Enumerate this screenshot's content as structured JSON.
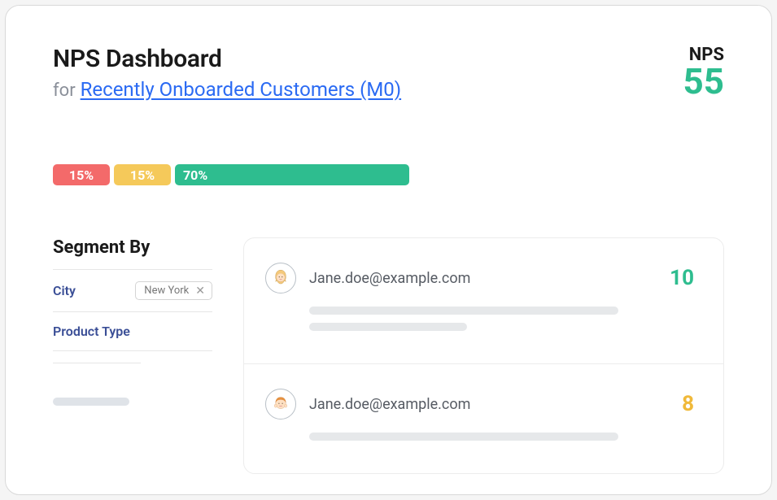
{
  "header": {
    "title": "NPS Dashboard",
    "for_prefix": "for",
    "segment_link": "Recently Onboarded Customers (M0)",
    "nps_label": "NPS",
    "nps_value": "55"
  },
  "distribution": {
    "detractor_pct": "15%",
    "passive_pct": "15%",
    "promoter_pct": "70%"
  },
  "segment_by": {
    "title": "Segment By",
    "rows": [
      {
        "label": "City",
        "chip": "New York"
      },
      {
        "label": "Product Type"
      }
    ]
  },
  "responses": [
    {
      "email": "Jane.doe@example.com",
      "score": "10",
      "score_class": "green",
      "avatar": "female"
    },
    {
      "email": "Jane.doe@example.com",
      "score": "8",
      "score_class": "yellow",
      "avatar": "male"
    }
  ]
}
